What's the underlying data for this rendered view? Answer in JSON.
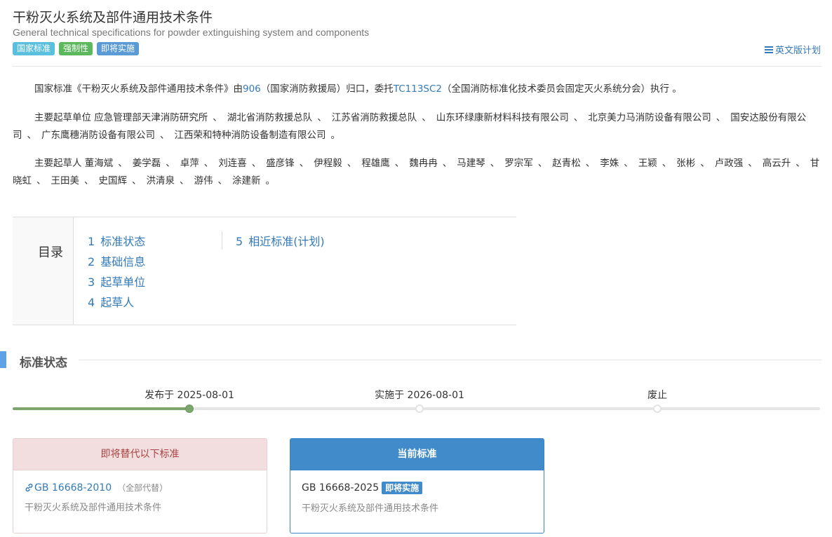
{
  "header": {
    "title": "干粉灭火系统及部件通用技术条件",
    "subtitle": "General technical specifications for powder extinguishing system and components",
    "tags": [
      {
        "label": "国家标准",
        "color": "#5bc0de"
      },
      {
        "label": "强制性",
        "color": "#5cb85c"
      },
      {
        "label": "即将实施",
        "color": "#5b9bd5"
      }
    ],
    "english_plan_link": "英文版计划"
  },
  "intro": {
    "p1_prefix": "国家标准《干粉灭火系统及部件通用技术条件》由",
    "p1_dept_code": "906",
    "p1_mid": "（国家消防救援局）归口，委托",
    "p1_tc_code": "TC113SC2",
    "p1_suffix": "（全国消防标准化技术委员会固定灭火系统分会）执行 。",
    "drafting_units_label": "主要起草单位",
    "drafting_units": [
      "应急管理部天津消防研究所",
      "湖北省消防救援总队",
      "江苏省消防救援总队",
      "山东环绿康新材料科技有限公司",
      "北京美力马消防设备有限公司",
      "国安达股份有限公司",
      "广东鹰穗消防设备有限公司",
      "江西荣和特种消防设备制造有限公司"
    ],
    "drafters_label": "主要起草人",
    "drafters": [
      "董海斌",
      "姜学磊",
      "卓萍",
      "刘连喜",
      "盛彦锋",
      "伊程毅",
      "程雄鹰",
      "魏冉冉",
      "马建琴",
      "罗宗军",
      "赵青松",
      "李姝",
      "王颖",
      "张彬",
      "卢政强",
      "高云升",
      "甘晓虹",
      "王田美",
      "史国辉",
      "洪清泉",
      "游伟",
      "涂建新"
    ],
    "list_separator": "、",
    "list_end": "。"
  },
  "toc": {
    "heading": "目录",
    "items": [
      {
        "num": "1",
        "label": "标准状态"
      },
      {
        "num": "2",
        "label": "基础信息"
      },
      {
        "num": "3",
        "label": "起草单位"
      },
      {
        "num": "4",
        "label": "起草人"
      },
      {
        "num": "5",
        "label": "相近标准(计划)"
      }
    ]
  },
  "status_section": {
    "title": "标准状态",
    "timeline": [
      {
        "label": "发布于 2025-08-01",
        "state": "done"
      },
      {
        "label": "实施于 2026-08-01",
        "state": "pending"
      },
      {
        "label": "废止",
        "state": "pending"
      }
    ],
    "colors": {
      "done": "#7da66d",
      "pending": "#e5e5e5"
    }
  },
  "cards": {
    "replaced": {
      "header": "即将替代以下标准",
      "code": "GB 16668-2010",
      "note": "（全部代替）",
      "name": "干粉灭火系统及部件通用技术条件"
    },
    "current": {
      "header": "当前标准",
      "code": "GB 16668-2025",
      "badge": "即将实施",
      "name": "干粉灭火系统及部件通用技术条件"
    }
  }
}
